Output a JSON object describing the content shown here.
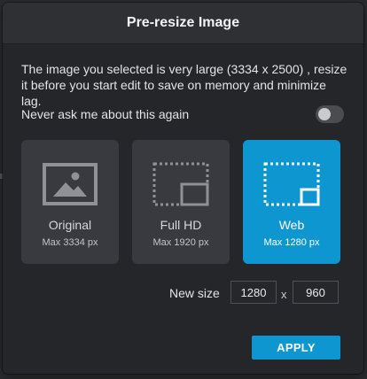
{
  "dialog": {
    "title": "Pre-resize Image",
    "message": "The image you selected is very large (3334 x 2500) , resize it before you start edit to save on memory and minimize lag.",
    "toggle": {
      "label": "Never ask me about this again",
      "checked": false
    },
    "options": [
      {
        "name": "Original",
        "max": "Max 3334 px",
        "icon": "image-icon",
        "selected": false
      },
      {
        "name": "Full HD",
        "max": "Max 1920 px",
        "icon": "resize-icon",
        "selected": false
      },
      {
        "name": "Web",
        "max": "Max 1280 px",
        "icon": "resize-icon",
        "selected": true
      }
    ],
    "new_size": {
      "label": "New size",
      "width": "1280",
      "separator": "x",
      "height": "960"
    },
    "apply_label": "APPLY"
  },
  "colors": {
    "accent": "#0d96d0",
    "dialog_bg": "#24262a",
    "card_bg": "#383a3f"
  }
}
